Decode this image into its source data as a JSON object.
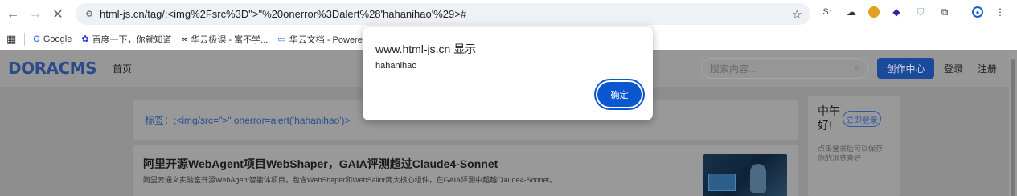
{
  "browser": {
    "url": "html-js.cn/tag/;<img%2Fsrc%3D\">\"%20onerror%3Dalert%28'hahanihao'%29>#",
    "nav": {
      "back": "←",
      "forward": "→",
      "stop": "✕"
    },
    "site_info_icon": "⚙",
    "star_icon": "☆",
    "extensions": [
      "ext-s7",
      "ext-cloud",
      "ext-cookie",
      "ext-diamond",
      "ext-shield",
      "ext-puzzle",
      "ext-profile",
      "ext-menu"
    ]
  },
  "bookmarks": {
    "apps_icon": "▦",
    "items": [
      {
        "icon": "G",
        "label": "Google"
      },
      {
        "icon": "✿",
        "label": "百度一下，你就知道"
      },
      {
        "icon": "∞",
        "label": "华云极课 - 富不学..."
      },
      {
        "icon": "▭",
        "label": "华云文档 - Powere"
      }
    ]
  },
  "site": {
    "logo": "DORACMS",
    "nav_home": "首页",
    "search_placeholder": "搜索内容...",
    "create_label": "创作中心",
    "login_label": "登录",
    "register_label": "注册"
  },
  "tag_label": "标签：;<img/src=\">\" onerror=alert('hahanihao')>",
  "article": {
    "title": "阿里开源WebAgent项目WebShaper，GAIA评测超过Claude4-Sonnet",
    "desc": "阿里云通义实验室开源WebAgent智能体项目，包含WebShaper和WebSailor两大核心组件，在GAIA评测中超越Claude4-Sonnet。..."
  },
  "sidebar": {
    "greeting": "中午好!",
    "login_now": "立即登录",
    "note": "点击登录后可以保存你的浏览喜好"
  },
  "dialog": {
    "title": "www.html-js.cn 显示",
    "message": "hahanihao",
    "ok_label": "确定"
  },
  "colors": {
    "dialog_button": "#0b57d0",
    "brand_blue": "#1c4a9a",
    "overlay": "#8e8e8e"
  }
}
